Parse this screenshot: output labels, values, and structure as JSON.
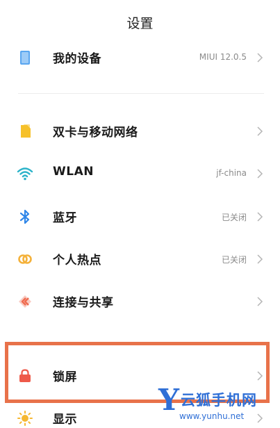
{
  "header": {
    "title": "设置"
  },
  "items": [
    {
      "label": "我的设备",
      "value": "MIUI 12.0.5",
      "icon": "device-icon",
      "color": "#5aa6f0"
    },
    {
      "label": "双卡与移动网络",
      "value": "",
      "icon": "sim-card-icon",
      "color": "#f6c12b"
    },
    {
      "label": "WLAN",
      "value": "jf-china",
      "icon": "wifi-icon",
      "color": "#2bb3c9"
    },
    {
      "label": "蓝牙",
      "value": "已关闭",
      "icon": "bluetooth-icon",
      "color": "#2f86e8"
    },
    {
      "label": "个人热点",
      "value": "已关闭",
      "icon": "hotspot-icon",
      "color": "#f4b13a"
    },
    {
      "label": "连接与共享",
      "value": "",
      "icon": "share-icon",
      "color": "#ef6b4f"
    },
    {
      "label": "锁屏",
      "value": "",
      "icon": "lock-icon",
      "color": "#ee5a4a"
    },
    {
      "label": "显示",
      "value": "",
      "icon": "sun-icon",
      "color": "#f5b731"
    }
  ],
  "highlight": {
    "color": "#e8724a"
  },
  "watermark": {
    "logo": "Y",
    "brand": "云狐手机网",
    "url": "www.yunhu.net",
    "color": "#2f6fd6"
  }
}
